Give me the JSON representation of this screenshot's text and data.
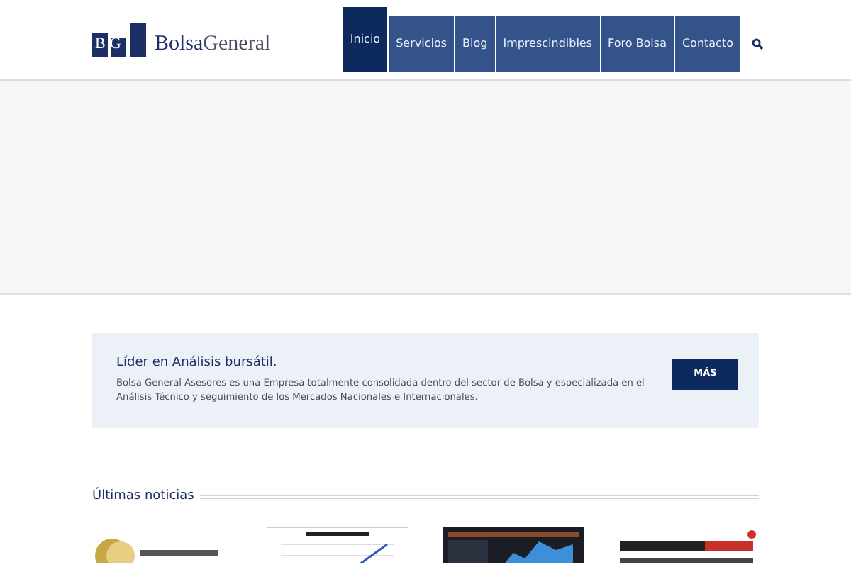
{
  "logo": {
    "mark": "BG",
    "name_bold": "Bolsa",
    "name_rest": "General"
  },
  "nav": [
    {
      "label": "Inicio",
      "selected": true
    },
    {
      "label": "Servicios",
      "selected": false
    },
    {
      "label": "Blog",
      "selected": false
    },
    {
      "label": "Imprescindibles",
      "selected": false
    },
    {
      "label": "Foro Bolsa",
      "selected": false
    },
    {
      "label": "Contacto",
      "selected": false
    }
  ],
  "intro": {
    "title": "Líder en Análisis bursátil.",
    "text": "Bolsa General Asesores es una Empresa totalmente consolidada dentro del sector de Bolsa y especializada en el Análisis Técnico y seguimiento de los Mercados Nacionales e Internacionales.",
    "button": "MÁS"
  },
  "news": {
    "heading": "Últimas noticias"
  }
}
